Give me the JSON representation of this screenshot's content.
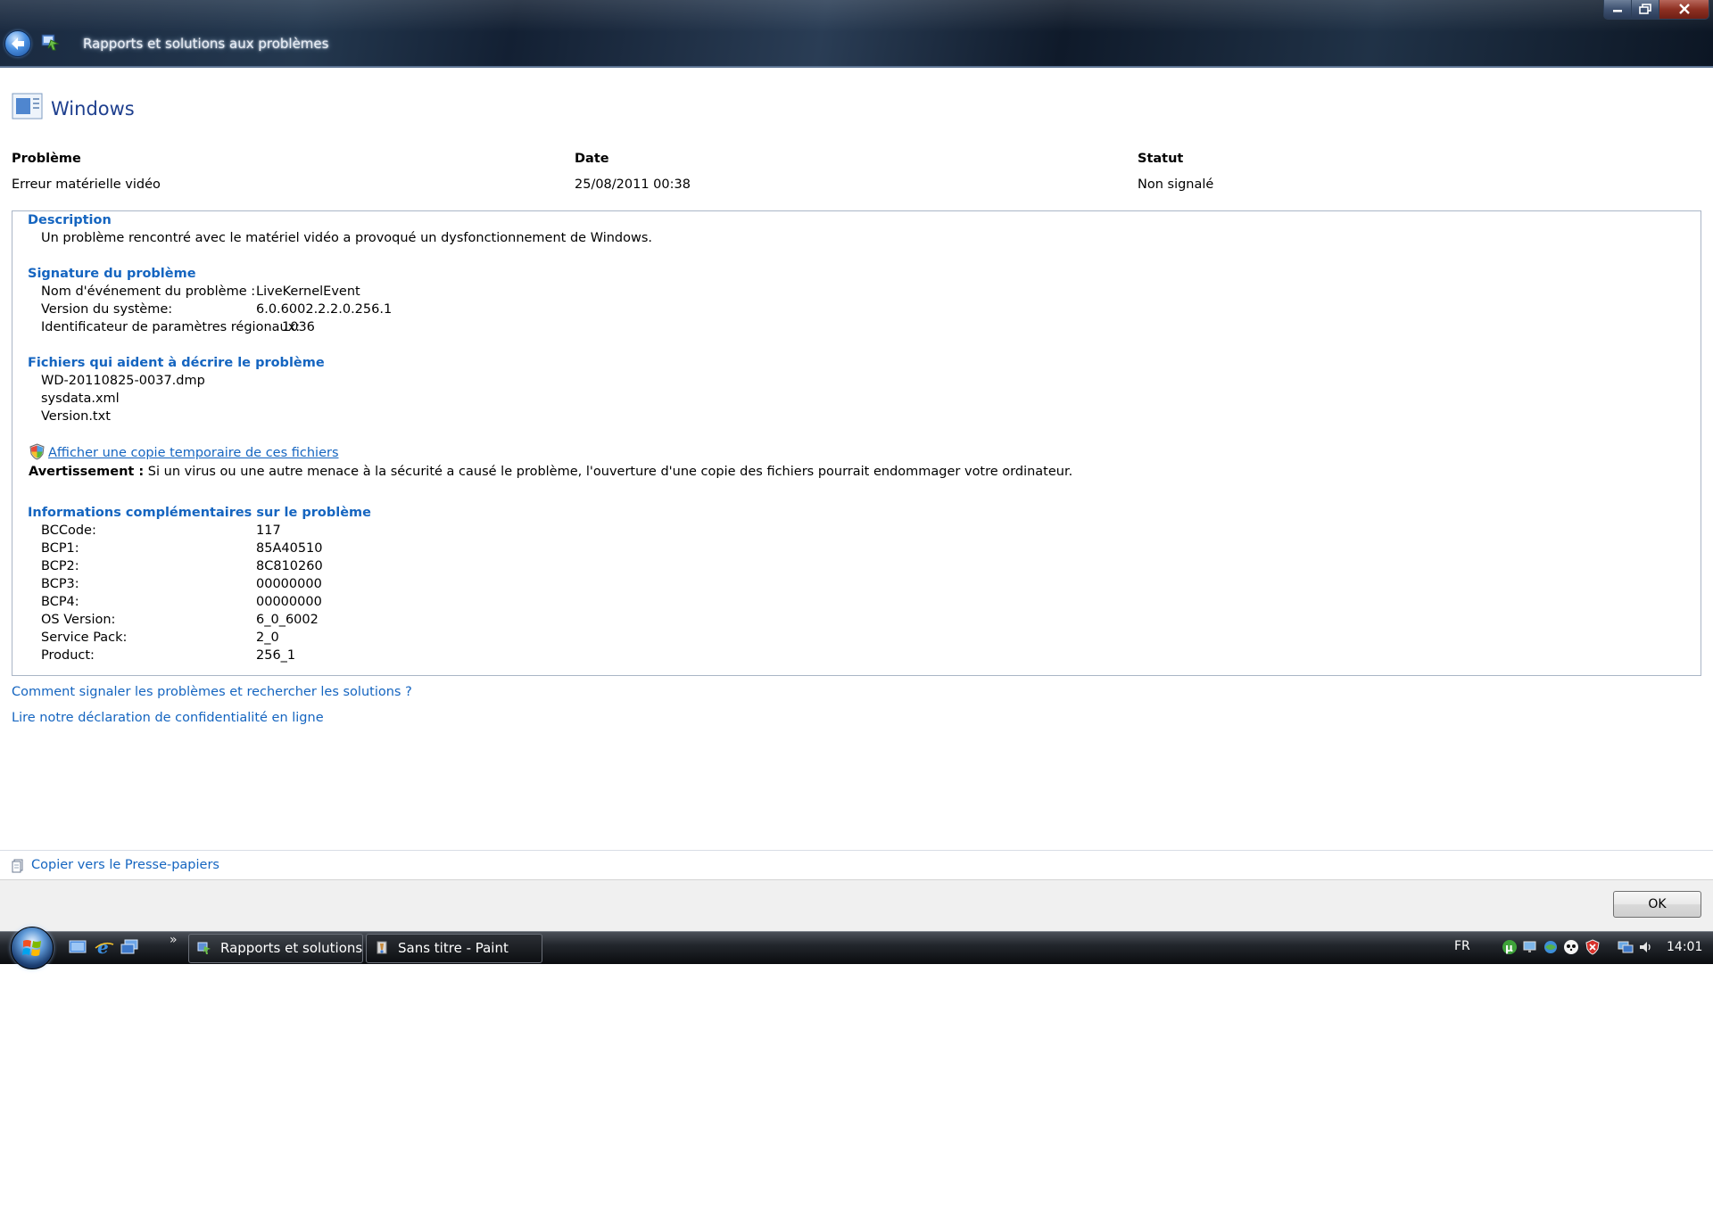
{
  "window": {
    "title": "Rapports et solutions aux problèmes"
  },
  "page": {
    "title": "Windows"
  },
  "summary": {
    "headers": {
      "problem": "Problème",
      "date": "Date",
      "status": "Statut"
    },
    "values": {
      "problem": "Erreur matérielle vidéo",
      "date": "25/08/2011 00:38",
      "status": "Non signalé"
    }
  },
  "description": {
    "heading": "Description",
    "text": "Un problème rencontré avec le matériel vidéo a provoqué un dysfonctionnement de Windows."
  },
  "signature": {
    "heading": "Signature du problème",
    "rows": [
      {
        "label": "Nom d'événement du problème :",
        "value": "LiveKernelEvent"
      },
      {
        "label": "Version du système:",
        "value": "6.0.6002.2.2.0.256.1"
      },
      {
        "label": "Identificateur de paramètres régionaux:",
        "value": "1036"
      }
    ]
  },
  "files": {
    "heading": "Fichiers qui aident à décrire le problème",
    "items": [
      "WD-20110825-0037.dmp",
      "sysdata.xml",
      "Version.txt"
    ],
    "link": "Afficher une copie temporaire de ces fichiers",
    "warning_label": "Avertissement :",
    "warning_text": " Si un virus ou une autre menace à la sécurité a causé le problème, l'ouverture d'une copie des fichiers pourrait endommager votre ordinateur."
  },
  "extra": {
    "heading": "Informations complémentaires sur le problème",
    "rows": [
      {
        "label": "BCCode:",
        "value": "117"
      },
      {
        "label": "BCP1:",
        "value": "85A40510"
      },
      {
        "label": "BCP2:",
        "value": "8C810260"
      },
      {
        "label": "BCP3:",
        "value": "00000000"
      },
      {
        "label": "BCP4:",
        "value": "00000000"
      },
      {
        "label": "OS Version:",
        "value": "6_0_6002"
      },
      {
        "label": "Service Pack:",
        "value": "2_0"
      },
      {
        "label": "Product:",
        "value": "256_1"
      }
    ]
  },
  "links": {
    "how_to_report": "Comment signaler les problèmes et rechercher les solutions ?",
    "privacy": "Lire notre déclaration de confidentialité en ligne",
    "copy_clipboard": "Copier vers le Presse-papiers"
  },
  "buttons": {
    "ok": "OK"
  },
  "taskbar": {
    "quicklaunch_more": "»",
    "tasks": [
      {
        "label": "Rapports et solutions..."
      },
      {
        "label": "Sans titre - Paint"
      }
    ],
    "language": "FR",
    "clock": "14:01"
  }
}
